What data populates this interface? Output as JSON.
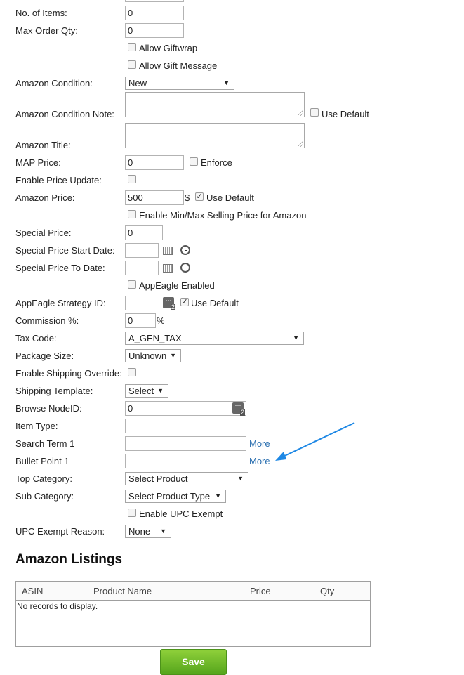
{
  "form": {
    "num_items": {
      "label": "No. of Items:",
      "value": "0"
    },
    "max_order_qty": {
      "label": "Max Order Qty:",
      "value": "0"
    },
    "allow_giftwrap": {
      "label": "Allow Giftwrap",
      "checked": false
    },
    "allow_gift_message": {
      "label": "Allow Gift Message",
      "checked": false
    },
    "amazon_condition": {
      "label": "Amazon Condition:",
      "value": "New"
    },
    "amazon_condition_note": {
      "label": "Amazon Condition Note:",
      "use_default": "Use Default"
    },
    "amazon_title": {
      "label": "Amazon Title:"
    },
    "map_price": {
      "label": "MAP Price:",
      "value": "0",
      "enforce": "Enforce"
    },
    "enable_price_update": {
      "label": "Enable Price Update:"
    },
    "amazon_price": {
      "label": "Amazon Price:",
      "value": "500",
      "currency": "$",
      "use_default": "Use Default",
      "use_default_checked": true
    },
    "enable_min_max": {
      "label": "Enable Min/Max Selling Price for Amazon"
    },
    "special_price": {
      "label": "Special Price:",
      "value": "0"
    },
    "special_price_start": {
      "label": "Special Price Start Date:"
    },
    "special_price_to": {
      "label": "Special Price To Date:"
    },
    "appeagle_enabled": {
      "label": "AppEagle Enabled"
    },
    "appeagle_strategy": {
      "label": "AppEagle Strategy ID:",
      "use_default": "Use Default",
      "use_default_checked": true
    },
    "commission": {
      "label": "Commission %:",
      "value": "0",
      "suffix": "%"
    },
    "tax_code": {
      "label": "Tax Code:",
      "value": "A_GEN_TAX"
    },
    "package_size": {
      "label": "Package Size:",
      "value": "Unknown"
    },
    "enable_shipping_override": {
      "label": "Enable Shipping Override:"
    },
    "shipping_template": {
      "label": "Shipping Template:",
      "value": "Select"
    },
    "browse_node": {
      "label": "Browse NodeID:",
      "value": "0"
    },
    "item_type": {
      "label": "Item Type:"
    },
    "search_term": {
      "label": "Search Term 1",
      "more": "More"
    },
    "bullet_point": {
      "label": "Bullet Point 1",
      "more": "More"
    },
    "top_category": {
      "label": "Top Category:",
      "value": "Select Product"
    },
    "sub_category": {
      "label": "Sub Category:",
      "value": "Select Product Type"
    },
    "enable_upc_exempt": {
      "label": "Enable UPC Exempt"
    },
    "upc_exempt_reason": {
      "label": "UPC Exempt Reason:",
      "value": "None"
    }
  },
  "listings": {
    "title": "Amazon Listings",
    "columns": [
      "ASIN",
      "Product Name",
      "Price",
      "Qty"
    ],
    "empty_text": "No records to display."
  },
  "save_label": "Save",
  "colors": {
    "link": "#2a6fb0",
    "save_green": "#6cbb26",
    "annotation_arrow": "#1e88e5"
  },
  "picker_badge": "2"
}
